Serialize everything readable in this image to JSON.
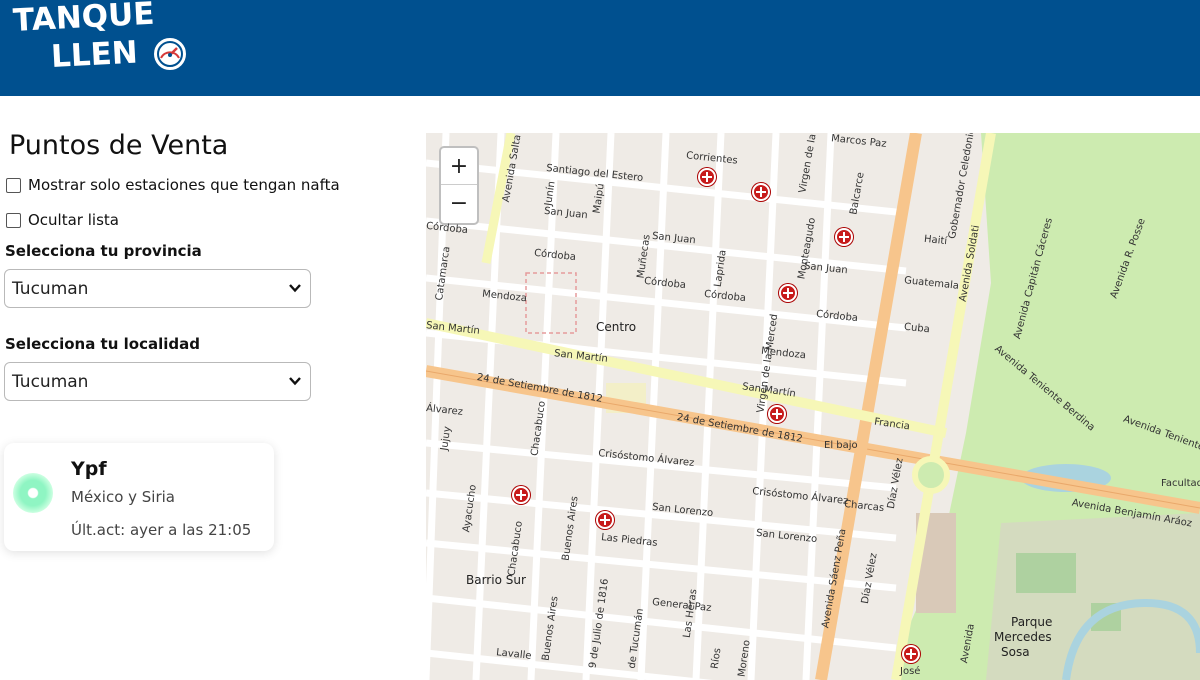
{
  "header": {
    "logo_line1": "TANQUE",
    "logo_line2": "LLEN",
    "brand_color": "#00508f"
  },
  "sidebar": {
    "title": "Puntos de Venta",
    "checkbox_nafta": "Mostrar solo estaciones que tengan nafta",
    "checkbox_hide_list": "Ocultar lista",
    "province_label": "Selecciona tu provincia",
    "province_value": "Tucuman",
    "locality_label": "Selecciona tu localidad",
    "locality_value": "Tucuman"
  },
  "station": {
    "name": "Ypf",
    "address": "México y Siria",
    "updated": "Últ.act: ayer a las 21:05",
    "status_color": "#8ff5c3"
  },
  "map": {
    "zoom_in": "+",
    "zoom_out": "−",
    "marker_icon": "fuel-station-marker-icon",
    "labels": {
      "santiago": "Santiago del Estero",
      "corrientes": "Corrientes",
      "virgen": "Virgen de la",
      "marcos_paz": "Marcos Paz",
      "av_salta_top": "Avenida Salta",
      "san_juan1": "San Juan",
      "san_juan2": "San Juan",
      "san_juan3": "San Juan",
      "cordoba1": "Córdoba",
      "cordoba2": "Córdoba",
      "cordoba3": "Córdoba",
      "cordoba4": "Córdoba",
      "cordoba5": "Córdoba",
      "mendoza1": "Mendoza",
      "mendoza2": "Mendoza",
      "centro": "Centro",
      "san_martin1": "San Martín",
      "san_martin2": "San Martín",
      "san_martin3": "San Martín",
      "sep24_1": "24 de Setiembre de 1812",
      "sep24_2": "24 de Setiembre de 1812",
      "el_bajo": "El bajo",
      "francia": "Francia",
      "crisostomo1": "Crisóstomo Álvarez",
      "crisostomo2": "Crisóstomo Álvarez",
      "san_lorenzo1": "San Lorenzo",
      "san_lorenzo2": "San Lorenzo",
      "las_piedras": "Las Piedras",
      "general_paz": "General Paz",
      "barrio_sur": "Barrio Sur",
      "lavalle": "Lavalle",
      "chacabuco1": "Chacabuco",
      "chacabuco2": "Chacabuco",
      "buenos_aires1": "Buenos Aires",
      "buenos_aires2": "Buenos Aires",
      "jujuy": "Jujuy",
      "ayacucho": "Ayacucho",
      "catamarca": "Catamarca",
      "junin": "Junín",
      "maipu": "Maipú",
      "laprida": "Laprida",
      "muñecas": "Muñecas",
      "montea": "Monteagudo",
      "balcarce": "Balcarce",
      "haiti": "Haití",
      "guatemala": "Guatemala",
      "cuba": "Cuba",
      "gob_celedonio": "Gobernador Celedonio",
      "av_soldati1": "Avenida Soldati",
      "av_soldati2": "Avenida",
      "av_capitan": "Avenida Capitán Cáceres",
      "av_posse": "Avenida R. Posse",
      "av_teniente1": "Avenida Teniente Berdina",
      "av_teniente2": "Avenida Teniente",
      "av_benjamin": "Avenida Benjamín Aráoz",
      "av_saenz": "Avenida Sáenz Peña",
      "charcas1": "Charcas",
      "charcas2": "Charcas",
      "diaz_velez1": "Díaz Vélez",
      "diaz_velez2": "Díaz Vélez",
      "parque1": "Parque",
      "parque2": "Mercedes",
      "parque3": "Sosa",
      "facultad": "Facultad de Odontol",
      "jose": "José",
      "julio": "9 de Julio de 1816",
      "tucuman": "de Tucumán",
      "las_heras": "Las Heras",
      "rios": "Ríos",
      "moreno": "Moreno",
      "alvarez_left": "Álvarez",
      "martin_left": "San Martín",
      "virgen_merced": "Virgen de la Merced"
    }
  }
}
